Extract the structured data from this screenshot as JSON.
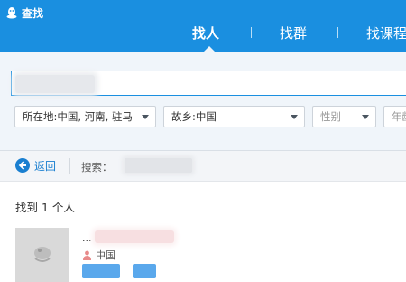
{
  "header": {
    "app_title": "查找",
    "tabs": [
      {
        "label": "找人",
        "active": true
      },
      {
        "label": "找群",
        "active": false
      },
      {
        "label": "找课程",
        "active": false
      }
    ],
    "bg_color": "#1a8fe0"
  },
  "search": {
    "keyword_value": ""
  },
  "filters": {
    "location": "所在地:中国, 河南, 驻马",
    "hometown": "故乡:中国",
    "gender_placeholder": "性别",
    "age_placeholder": "年龄"
  },
  "back_bar": {
    "back_label": "返回",
    "search_label": "搜索："
  },
  "results": {
    "count_text": "找到 1 个人",
    "people": [
      {
        "nickname": "...",
        "location": "中国",
        "actions": [
          "",
          ""
        ]
      }
    ]
  }
}
